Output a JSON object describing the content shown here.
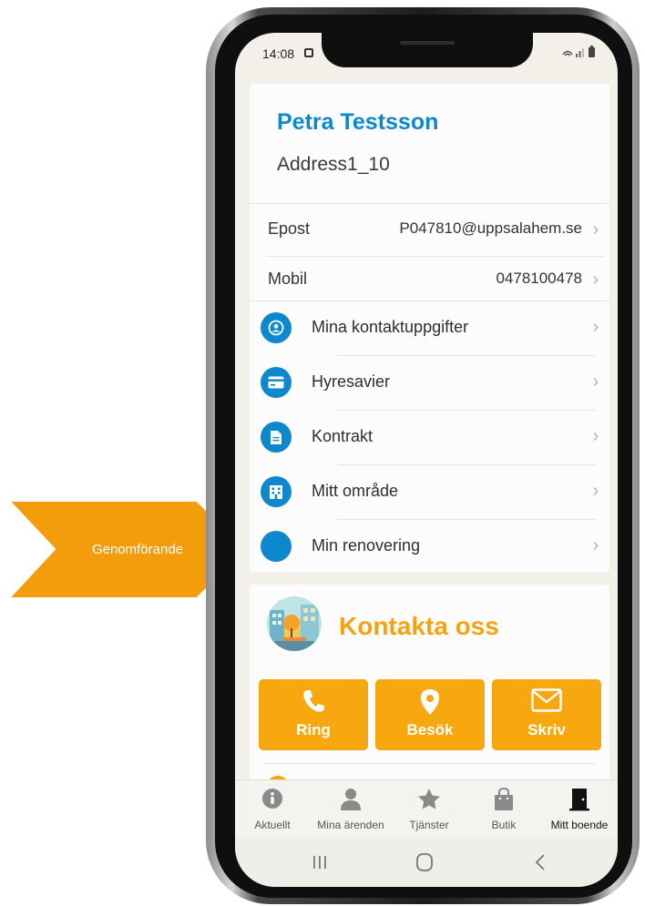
{
  "callout": {
    "label": "Genomförande",
    "color": "#f39c0c"
  },
  "status_bar": {
    "time": "14:08"
  },
  "profile": {
    "name": "Petra Testsson",
    "address": "Address1_10"
  },
  "info_rows": [
    {
      "label": "Epost",
      "value": "P047810@uppsalahem.se"
    },
    {
      "label": "Mobil",
      "value": "0478100478"
    }
  ],
  "menu_items": [
    {
      "label": "Mina kontaktuppgifter",
      "icon": "user-circle-icon"
    },
    {
      "label": "Hyresavier",
      "icon": "credit-card-icon"
    },
    {
      "label": "Kontrakt",
      "icon": "document-icon"
    },
    {
      "label": "Mitt område",
      "icon": "building-icon"
    },
    {
      "label": "Min renovering",
      "icon": "blank-circle-icon"
    }
  ],
  "contact": {
    "title": "Kontakta oss",
    "buttons": [
      {
        "label": "Ring",
        "icon": "phone-icon"
      },
      {
        "label": "Besök",
        "icon": "location-pin-icon"
      },
      {
        "label": "Skriv",
        "icon": "envelope-icon"
      }
    ]
  },
  "tabs": [
    {
      "label": "Aktuellt",
      "icon": "info-icon"
    },
    {
      "label": "Mina ärenden",
      "icon": "person-icon"
    },
    {
      "label": "Tjänster",
      "icon": "star-icon"
    },
    {
      "label": "Butik",
      "icon": "shopping-bag-icon"
    },
    {
      "label": "Mitt boende",
      "icon": "door-icon",
      "active": true
    }
  ],
  "colors": {
    "primary_blue": "#0e88cc",
    "accent_orange": "#f7a80f",
    "screen_background": "#f3f0ea"
  }
}
